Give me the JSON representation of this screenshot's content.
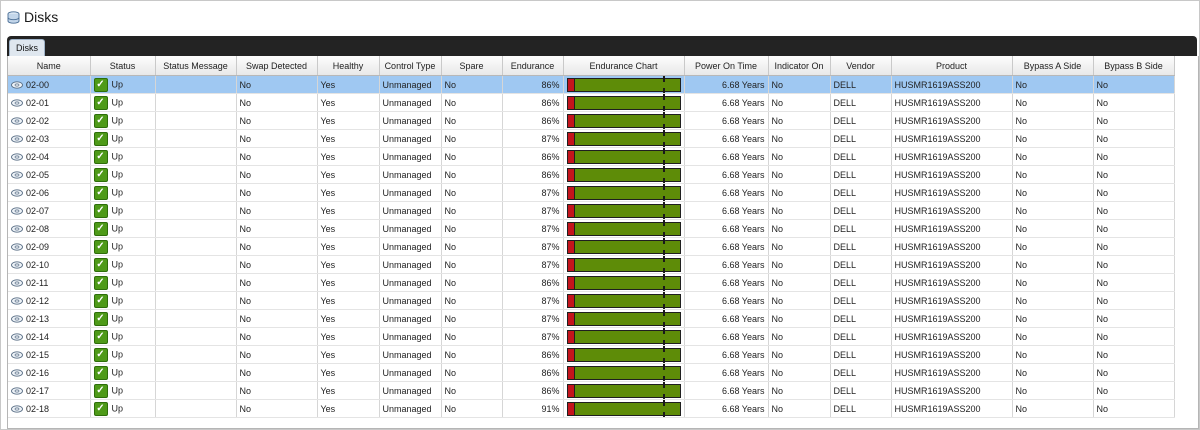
{
  "window": {
    "title": "Disks",
    "icon": "disks-icon"
  },
  "tabs": [
    {
      "label": "Disks"
    }
  ],
  "columns": [
    "Name",
    "Status",
    "Status Message",
    "Swap Detected",
    "Healthy",
    "Control Type",
    "Spare",
    "Endurance",
    "Endurance Chart",
    "Power On Time",
    "Indicator On",
    "Vendor",
    "Product",
    "Bypass A Side",
    "Bypass B Side"
  ],
  "rows": [
    {
      "name": "02-00",
      "status": "Up",
      "status_message": "",
      "swap": "No",
      "healthy": "Yes",
      "control": "Unmanaged",
      "spare": "No",
      "endurance": "86%",
      "endurance_value": 86,
      "power": "6.68 Years",
      "indicator": "No",
      "vendor": "DELL",
      "product": "HUSMR1619ASS200",
      "bypass_a": "No",
      "bypass_b": "No",
      "selected": true
    },
    {
      "name": "02-01",
      "status": "Up",
      "status_message": "",
      "swap": "No",
      "healthy": "Yes",
      "control": "Unmanaged",
      "spare": "No",
      "endurance": "86%",
      "endurance_value": 86,
      "power": "6.68 Years",
      "indicator": "No",
      "vendor": "DELL",
      "product": "HUSMR1619ASS200",
      "bypass_a": "No",
      "bypass_b": "No"
    },
    {
      "name": "02-02",
      "status": "Up",
      "status_message": "",
      "swap": "No",
      "healthy": "Yes",
      "control": "Unmanaged",
      "spare": "No",
      "endurance": "86%",
      "endurance_value": 86,
      "power": "6.68 Years",
      "indicator": "No",
      "vendor": "DELL",
      "product": "HUSMR1619ASS200",
      "bypass_a": "No",
      "bypass_b": "No"
    },
    {
      "name": "02-03",
      "status": "Up",
      "status_message": "",
      "swap": "No",
      "healthy": "Yes",
      "control": "Unmanaged",
      "spare": "No",
      "endurance": "87%",
      "endurance_value": 87,
      "power": "6.68 Years",
      "indicator": "No",
      "vendor": "DELL",
      "product": "HUSMR1619ASS200",
      "bypass_a": "No",
      "bypass_b": "No"
    },
    {
      "name": "02-04",
      "status": "Up",
      "status_message": "",
      "swap": "No",
      "healthy": "Yes",
      "control": "Unmanaged",
      "spare": "No",
      "endurance": "86%",
      "endurance_value": 86,
      "power": "6.68 Years",
      "indicator": "No",
      "vendor": "DELL",
      "product": "HUSMR1619ASS200",
      "bypass_a": "No",
      "bypass_b": "No"
    },
    {
      "name": "02-05",
      "status": "Up",
      "status_message": "",
      "swap": "No",
      "healthy": "Yes",
      "control": "Unmanaged",
      "spare": "No",
      "endurance": "86%",
      "endurance_value": 86,
      "power": "6.68 Years",
      "indicator": "No",
      "vendor": "DELL",
      "product": "HUSMR1619ASS200",
      "bypass_a": "No",
      "bypass_b": "No"
    },
    {
      "name": "02-06",
      "status": "Up",
      "status_message": "",
      "swap": "No",
      "healthy": "Yes",
      "control": "Unmanaged",
      "spare": "No",
      "endurance": "87%",
      "endurance_value": 87,
      "power": "6.68 Years",
      "indicator": "No",
      "vendor": "DELL",
      "product": "HUSMR1619ASS200",
      "bypass_a": "No",
      "bypass_b": "No"
    },
    {
      "name": "02-07",
      "status": "Up",
      "status_message": "",
      "swap": "No",
      "healthy": "Yes",
      "control": "Unmanaged",
      "spare": "No",
      "endurance": "87%",
      "endurance_value": 87,
      "power": "6.68 Years",
      "indicator": "No",
      "vendor": "DELL",
      "product": "HUSMR1619ASS200",
      "bypass_a": "No",
      "bypass_b": "No"
    },
    {
      "name": "02-08",
      "status": "Up",
      "status_message": "",
      "swap": "No",
      "healthy": "Yes",
      "control": "Unmanaged",
      "spare": "No",
      "endurance": "87%",
      "endurance_value": 87,
      "power": "6.68 Years",
      "indicator": "No",
      "vendor": "DELL",
      "product": "HUSMR1619ASS200",
      "bypass_a": "No",
      "bypass_b": "No"
    },
    {
      "name": "02-09",
      "status": "Up",
      "status_message": "",
      "swap": "No",
      "healthy": "Yes",
      "control": "Unmanaged",
      "spare": "No",
      "endurance": "87%",
      "endurance_value": 87,
      "power": "6.68 Years",
      "indicator": "No",
      "vendor": "DELL",
      "product": "HUSMR1619ASS200",
      "bypass_a": "No",
      "bypass_b": "No"
    },
    {
      "name": "02-10",
      "status": "Up",
      "status_message": "",
      "swap": "No",
      "healthy": "Yes",
      "control": "Unmanaged",
      "spare": "No",
      "endurance": "87%",
      "endurance_value": 87,
      "power": "6.68 Years",
      "indicator": "No",
      "vendor": "DELL",
      "product": "HUSMR1619ASS200",
      "bypass_a": "No",
      "bypass_b": "No"
    },
    {
      "name": "02-11",
      "status": "Up",
      "status_message": "",
      "swap": "No",
      "healthy": "Yes",
      "control": "Unmanaged",
      "spare": "No",
      "endurance": "86%",
      "endurance_value": 86,
      "power": "6.68 Years",
      "indicator": "No",
      "vendor": "DELL",
      "product": "HUSMR1619ASS200",
      "bypass_a": "No",
      "bypass_b": "No"
    },
    {
      "name": "02-12",
      "status": "Up",
      "status_message": "",
      "swap": "No",
      "healthy": "Yes",
      "control": "Unmanaged",
      "spare": "No",
      "endurance": "87%",
      "endurance_value": 87,
      "power": "6.68 Years",
      "indicator": "No",
      "vendor": "DELL",
      "product": "HUSMR1619ASS200",
      "bypass_a": "No",
      "bypass_b": "No"
    },
    {
      "name": "02-13",
      "status": "Up",
      "status_message": "",
      "swap": "No",
      "healthy": "Yes",
      "control": "Unmanaged",
      "spare": "No",
      "endurance": "87%",
      "endurance_value": 87,
      "power": "6.68 Years",
      "indicator": "No",
      "vendor": "DELL",
      "product": "HUSMR1619ASS200",
      "bypass_a": "No",
      "bypass_b": "No"
    },
    {
      "name": "02-14",
      "status": "Up",
      "status_message": "",
      "swap": "No",
      "healthy": "Yes",
      "control": "Unmanaged",
      "spare": "No",
      "endurance": "87%",
      "endurance_value": 87,
      "power": "6.68 Years",
      "indicator": "No",
      "vendor": "DELL",
      "product": "HUSMR1619ASS200",
      "bypass_a": "No",
      "bypass_b": "No"
    },
    {
      "name": "02-15",
      "status": "Up",
      "status_message": "",
      "swap": "No",
      "healthy": "Yes",
      "control": "Unmanaged",
      "spare": "No",
      "endurance": "86%",
      "endurance_value": 86,
      "power": "6.68 Years",
      "indicator": "No",
      "vendor": "DELL",
      "product": "HUSMR1619ASS200",
      "bypass_a": "No",
      "bypass_b": "No"
    },
    {
      "name": "02-16",
      "status": "Up",
      "status_message": "",
      "swap": "No",
      "healthy": "Yes",
      "control": "Unmanaged",
      "spare": "No",
      "endurance": "86%",
      "endurance_value": 86,
      "power": "6.68 Years",
      "indicator": "No",
      "vendor": "DELL",
      "product": "HUSMR1619ASS200",
      "bypass_a": "No",
      "bypass_b": "No"
    },
    {
      "name": "02-17",
      "status": "Up",
      "status_message": "",
      "swap": "No",
      "healthy": "Yes",
      "control": "Unmanaged",
      "spare": "No",
      "endurance": "86%",
      "endurance_value": 86,
      "power": "6.68 Years",
      "indicator": "No",
      "vendor": "DELL",
      "product": "HUSMR1619ASS200",
      "bypass_a": "No",
      "bypass_b": "No"
    },
    {
      "name": "02-18",
      "status": "Up",
      "status_message": "",
      "swap": "No",
      "healthy": "Yes",
      "control": "Unmanaged",
      "spare": "No",
      "endurance": "91%",
      "endurance_value": 91,
      "power": "6.68 Years",
      "indicator": "No",
      "vendor": "DELL",
      "product": "HUSMR1619ASS200",
      "bypass_a": "No",
      "bypass_b": "No"
    }
  ],
  "colors": {
    "endurance_fill": "#5e8c08",
    "endurance_used": "#c4141c",
    "selection": "#9fc8f2",
    "status_ok": "#4e9a18",
    "tabbar": "#232323"
  }
}
